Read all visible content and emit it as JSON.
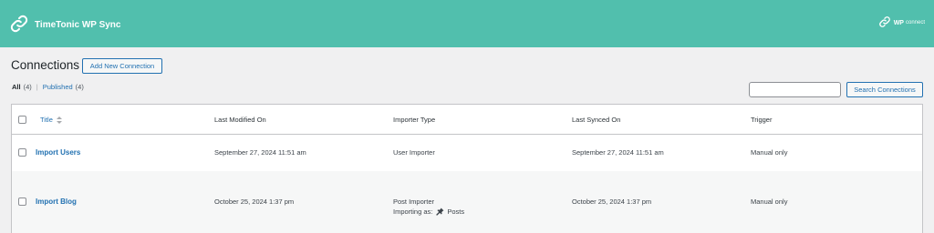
{
  "header": {
    "brand_name": "TimeTonic WP Sync",
    "wpconnect_wp": "WP",
    "wpconnect_text": "connect",
    "brand_icon": "link-icon",
    "bg_color": "#51bfad"
  },
  "page": {
    "title": "Connections",
    "add_button": "Add New Connection"
  },
  "filters": {
    "all_label": "All",
    "all_count": "(4)",
    "separator": "|",
    "published_label": "Published",
    "published_count": "(4)"
  },
  "search": {
    "value": "",
    "button_label": "Search Connections"
  },
  "table": {
    "columns": [
      "Title",
      "Last Modified On",
      "Importer Type",
      "Last Synced On",
      "Trigger"
    ],
    "rows": [
      {
        "title": "Import Users",
        "last_modified": "September 27, 2024 11:51 am",
        "importer_type": "User Importer",
        "importing_as": "",
        "importing_as_value": "",
        "last_synced": "September 27, 2024 11:51 am",
        "trigger": "Manual only"
      },
      {
        "title": "Import Blog",
        "last_modified": "October 25, 2024 1:37 pm",
        "importer_type": "Post Importer",
        "importing_as": "Importing as:",
        "importing_as_icon": "pushpin-icon",
        "importing_as_value": "Posts",
        "last_synced": "October 25, 2024 1:37 pm",
        "trigger": "Manual only"
      }
    ]
  }
}
